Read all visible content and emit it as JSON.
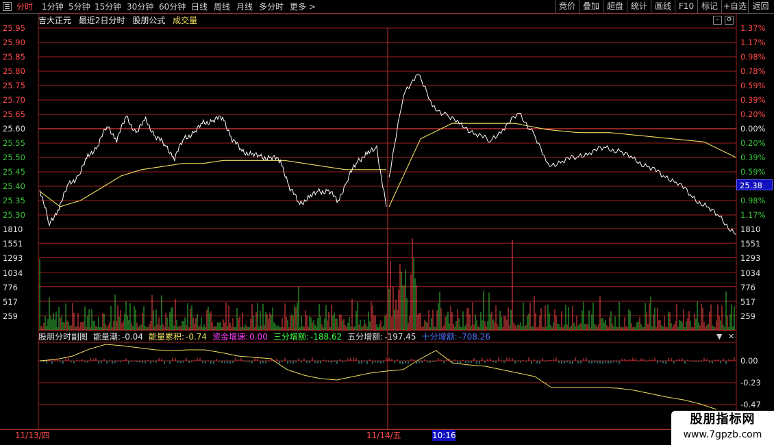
{
  "toolbar": {
    "tabs": [
      "分时",
      "1分钟",
      "5分钟",
      "15分钟",
      "30分钟",
      "60分钟",
      "日线",
      "周线",
      "月线",
      "多分时",
      "更多 >"
    ],
    "right_buttons": [
      "竞价",
      "叠加",
      "超盘",
      "统计",
      "画线",
      "F10",
      "标记",
      "+自选",
      "返回"
    ]
  },
  "title_bar": {
    "stock_name": "吉大正元",
    "period": "最近2日分时",
    "formula": "股朋公式",
    "volume_label": "成交量"
  },
  "price_axis": {
    "left": [
      "25.95",
      "25.90",
      "25.85",
      "25.80",
      "25.75",
      "25.70",
      "25.65",
      "25.60",
      "25.55",
      "25.50",
      "25.45",
      "25.40",
      "25.35",
      "25.30"
    ],
    "right": [
      "1.37%",
      "1.17%",
      "0.98%",
      "0.78%",
      "0.59%",
      "0.39%",
      "0.20%",
      "0.00%",
      "0.20%",
      "0.39%",
      "0.59%",
      "0.78%",
      "0.98%",
      "1.17%"
    ],
    "current_price": "25.38"
  },
  "volume_axis": {
    "labels": [
      "1810",
      "1551",
      "1293",
      "1034",
      "776",
      "517",
      "259"
    ]
  },
  "indicator": {
    "name": "股朋分时副图",
    "items": [
      {
        "label": "能量潮:",
        "value": "-0.04",
        "color": "white"
      },
      {
        "label": "能量累积:",
        "value": "-0.74",
        "color": "yellow"
      },
      {
        "label": "资金增速:",
        "value": "0.00",
        "color": "magenta"
      },
      {
        "label": "三分增额:",
        "value": "-188.62",
        "color": "green"
      },
      {
        "label": "五分增额:",
        "value": "-197.45",
        "color": "white"
      },
      {
        "label": "十分增额:",
        "value": "-708.26",
        "color": "blue"
      }
    ],
    "axis": [
      "0.00",
      "-0.23",
      "-0.47"
    ]
  },
  "dates": {
    "day1": "11/13/四",
    "day2": "11/14/五",
    "cursor_time": "10:16"
  },
  "watermark": {
    "line1": "股朋指标网",
    "line2": "www.7gpzb.com"
  },
  "colors": {
    "up": "#ff4848",
    "down": "#3ac43a",
    "price_line": "#ffffff",
    "avg_line": "#f0e060",
    "grid": "#a02020"
  },
  "chart_data": {
    "type": "line",
    "x_range": [
      "11/13 09:30",
      "11/14 15:00"
    ],
    "ylim": [
      25.3,
      25.95
    ],
    "base_price": 25.6,
    "series": [],
    "price": [
      25.46,
      25.34,
      25.4,
      25.47,
      25.5,
      25.56,
      25.6,
      25.66,
      25.62,
      25.69,
      25.64,
      25.68,
      25.63,
      25.6,
      25.56,
      25.62,
      25.64,
      25.67,
      25.68,
      25.69,
      25.62,
      25.58,
      25.57,
      25.56,
      25.56,
      25.55,
      25.46,
      25.41,
      25.43,
      25.45,
      25.45,
      25.42,
      25.49,
      25.55,
      25.57,
      25.59,
      25.4,
      25.5,
      25.76,
      25.84,
      25.72,
      25.7,
      25.66,
      25.64,
      25.61,
      25.66,
      25.7,
      25.64,
      25.53,
      25.55,
      25.56,
      25.58,
      25.59,
      25.58,
      25.55,
      25.53,
      25.5,
      25.48,
      25.43,
      25.4,
      25.36,
      25.31
    ],
    "avg_price": [
      25.45,
      25.4,
      25.42,
      25.46,
      25.5,
      25.52,
      25.53,
      25.54,
      25.54,
      25.55,
      25.55,
      25.55,
      25.55,
      25.54,
      25.53,
      25.52,
      25.52,
      25.52,
      25.4,
      25.62,
      25.67,
      25.67,
      25.67,
      25.65,
      25.64,
      25.64,
      25.63,
      25.62,
      25.61,
      25.56
    ],
    "volume_ylim": [
      0,
      1810
    ]
  }
}
